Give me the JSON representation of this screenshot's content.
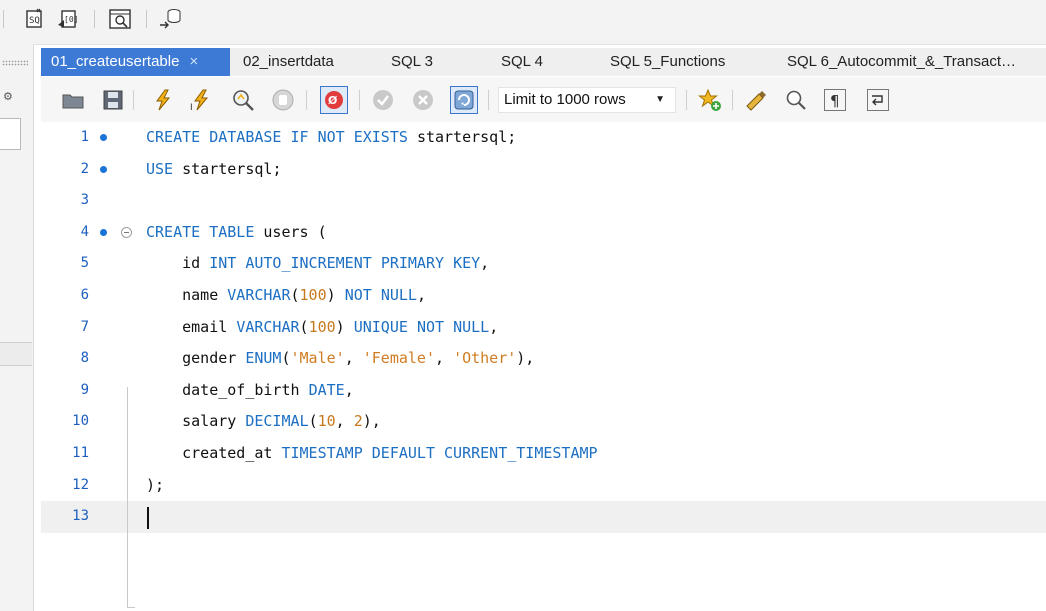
{
  "top_toolbar": {
    "icons": [
      "panel-icon",
      "new-sql-tab-icon",
      "open-sql-icon",
      "inspect-icon",
      "migration-icon"
    ]
  },
  "tabs": [
    {
      "label": "01_createusertable",
      "active": true,
      "close": "×"
    },
    {
      "label": "02_insertdata",
      "active": false
    },
    {
      "label": "SQL 3",
      "active": false
    },
    {
      "label": "SQL 4",
      "active": false
    },
    {
      "label": "SQL 5_Functions",
      "active": false
    },
    {
      "label": "SQL  6_Autocommit_&_Transact…",
      "active": false
    }
  ],
  "editor_toolbar": {
    "limit_label": "Limit to 1000 rows",
    "icons": [
      "open-folder-icon",
      "save-icon",
      "execute-icon",
      "execute-statement-icon",
      "explain-icon",
      "stop-icon",
      "stop-on-error-icon",
      "commit-icon",
      "rollback-icon",
      "autocommit-icon",
      "limit-dropdown",
      "add-snippet-icon",
      "beautify-icon",
      "find-icon",
      "invisibles-icon",
      "wrap-icon"
    ]
  },
  "editor": {
    "lines": [
      {
        "n": "1",
        "bullet": true,
        "text": "CREATE DATABASE IF NOT EXISTS startersql;"
      },
      {
        "n": "2",
        "bullet": true,
        "text": "USE startersql;"
      },
      {
        "n": "3",
        "bullet": false,
        "text": ""
      },
      {
        "n": "4",
        "bullet": true,
        "fold": true,
        "text": "CREATE TABLE users ("
      },
      {
        "n": "5",
        "bullet": false,
        "text": "    id INT AUTO_INCREMENT PRIMARY KEY,"
      },
      {
        "n": "6",
        "bullet": false,
        "text": "    name VARCHAR(100) NOT NULL,"
      },
      {
        "n": "7",
        "bullet": false,
        "text": "    email VARCHAR(100) UNIQUE NOT NULL,"
      },
      {
        "n": "8",
        "bullet": false,
        "text": "    gender ENUM('Male', 'Female', 'Other'),"
      },
      {
        "n": "9",
        "bullet": false,
        "text": "    date_of_birth DATE,"
      },
      {
        "n": "10",
        "bullet": false,
        "text": "    salary DECIMAL(10, 2),"
      },
      {
        "n": "11",
        "bullet": false,
        "text": "    created_at TIMESTAMP DEFAULT CURRENT_TIMESTAMP"
      },
      {
        "n": "12",
        "bullet": false,
        "text": ");"
      },
      {
        "n": "13",
        "bullet": false,
        "current": true,
        "text": ""
      }
    ]
  },
  "colors": {
    "keyword": "#1c6fc2",
    "number": "#c77a1d",
    "string": "#d07c22",
    "line_number": "#1d5fbf",
    "active_tab": "#3d7ad6"
  }
}
